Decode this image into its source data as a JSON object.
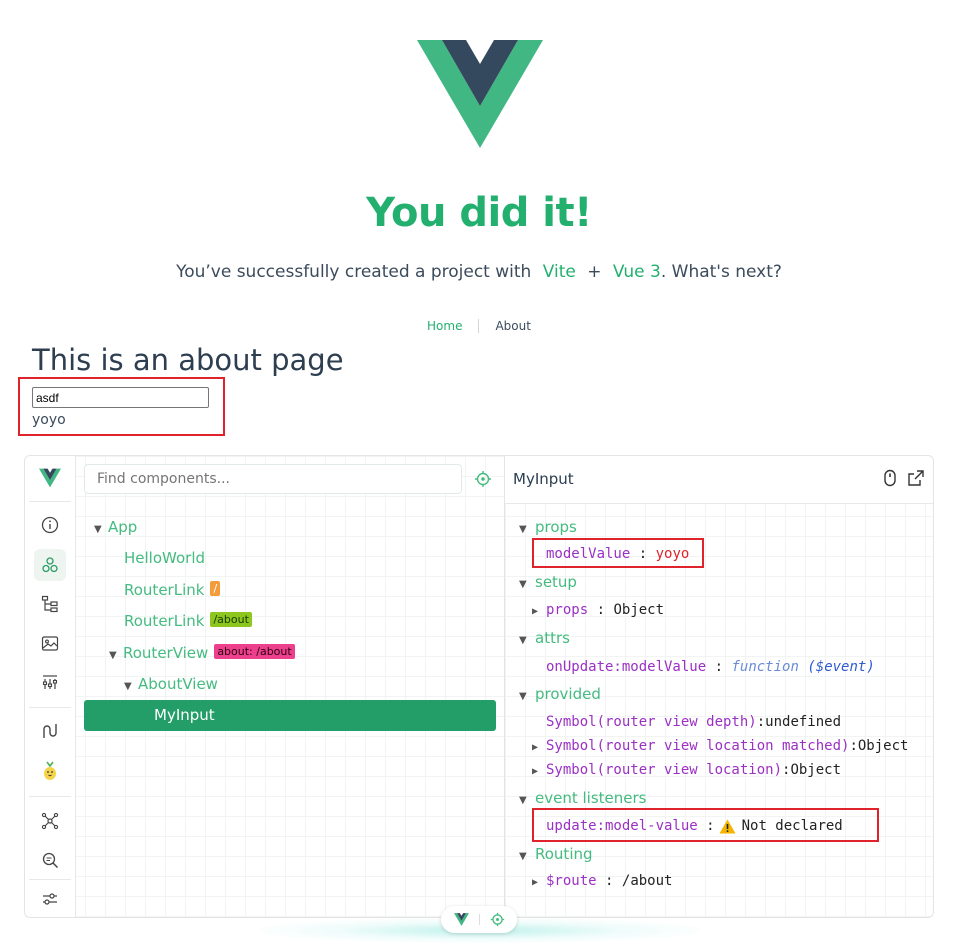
{
  "hero": {
    "title": "You did it!",
    "subtitle_prefix": "You’ve successfully created a project with",
    "link_vite": "Vite",
    "plus": "+",
    "link_vue": "Vue 3",
    "subtitle_suffix": ". What's next?"
  },
  "nav": {
    "home": "Home",
    "about": "About"
  },
  "page": {
    "title": "This is an about page",
    "input_value": "asdf",
    "output_text": "yoyo"
  },
  "devtools": {
    "search_placeholder": "Find components...",
    "tree": [
      {
        "label": "App"
      },
      {
        "label": "HelloWorld"
      },
      {
        "label": "RouterLink",
        "tag": "/"
      },
      {
        "label": "RouterLink",
        "tag": "/about"
      },
      {
        "label": "RouterView",
        "tag": "about: /about"
      },
      {
        "label": "AboutView"
      },
      {
        "label": "MyInput"
      }
    ],
    "inspector": {
      "component_name": "MyInput",
      "sections": {
        "props": "props",
        "setup": "setup",
        "attrs": "attrs",
        "provided": "provided",
        "event_listeners": "event listeners",
        "routing": "Routing"
      },
      "props": {
        "key": "modelValue",
        "value": "yoyo"
      },
      "setup": {
        "key": "props",
        "value": "Object"
      },
      "attrs": {
        "key": "onUpdate:modelValue",
        "value_kw": "function",
        "value_args": "($event)"
      },
      "provided": [
        {
          "key": "Symbol(router view depth)",
          "value": "undefined"
        },
        {
          "key": "Symbol(router view location matched)",
          "value": "Object"
        },
        {
          "key": "Symbol(router view location)",
          "value": "Object"
        }
      ],
      "event_listeners": {
        "key": "update:model-value",
        "value": "Not declared"
      },
      "routing": {
        "key": "$route",
        "value": "/about"
      },
      "separator": ":"
    }
  },
  "colors": {
    "accent": "#23b06e",
    "highlight": "#e0222a",
    "selected": "#239e69"
  }
}
